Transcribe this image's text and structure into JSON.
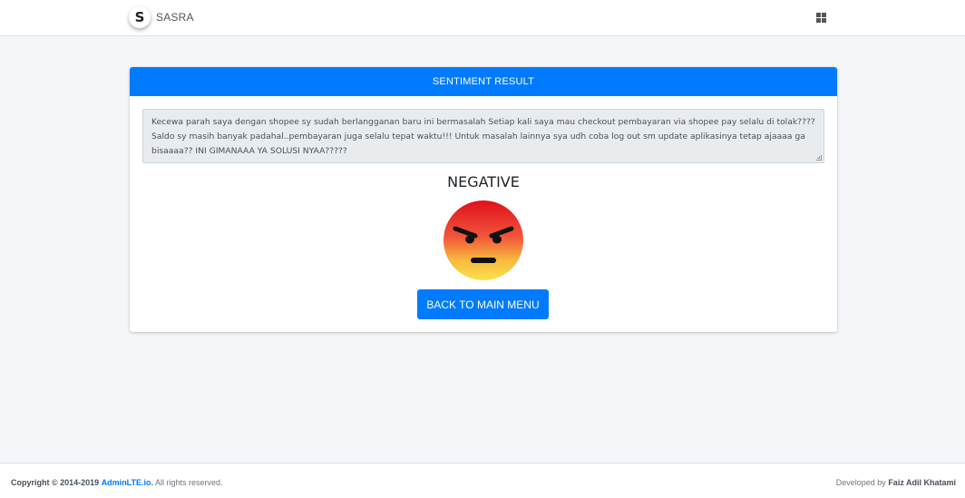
{
  "navbar": {
    "brand_logo_letter": "S",
    "brand_name": "SASRA",
    "apps_icon": "grid-icon"
  },
  "card": {
    "header": "SENTIMENT RESULT",
    "review_text": "Kecewa parah saya dengan shopee sy sudah berlangganan baru ini bermasalah Setiap kali saya mau checkout pembayaran via shopee pay selalu di tolak???? Saldo sy masih banyak padahal..pembayaran juga selalu tepat waktu!!! Untuk masalah lainnya sya udh coba log out sm update aplikasinya tetap ajaaaa ga bisaaaa?? INI GIMANAAA YA SOLUSI NYAA?????",
    "sentiment_label": "NEGATIVE",
    "sentiment_icon": "angry-face-icon",
    "back_button": "BACK TO MAIN MENU"
  },
  "footer": {
    "copyright_prefix": "Copyright © 2014-2019",
    "copyright_link": "AdminLTE.io.",
    "copyright_suffix": "All rights reserved.",
    "developed_by": "Developed by",
    "developer": "Faiz Adil Khatami"
  },
  "colors": {
    "primary": "#007bff",
    "background": "#f4f6f9"
  }
}
